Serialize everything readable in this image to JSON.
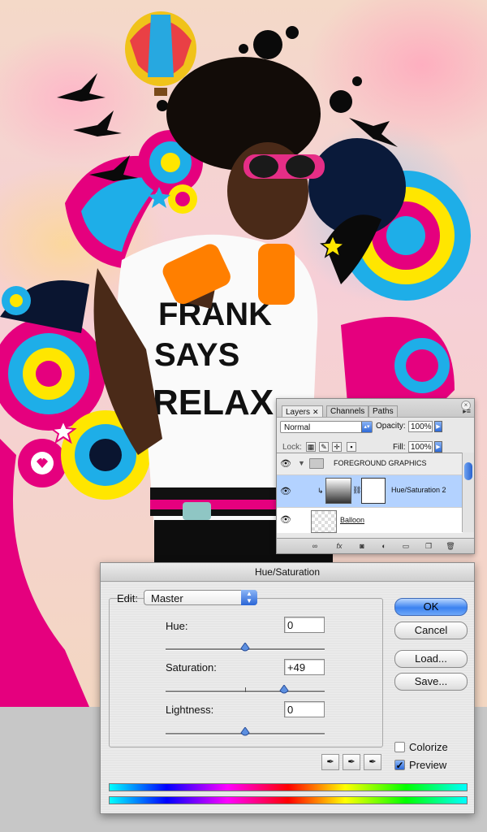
{
  "layers_panel": {
    "tabs": [
      "Layers",
      "Channels",
      "Paths"
    ],
    "tab_close": "✕",
    "blend_mode": "Normal",
    "opacity_label": "Opacity:",
    "opacity_value": "100%",
    "lock_label": "Lock:",
    "fill_label": "Fill:",
    "fill_value": "100%",
    "layers": [
      {
        "name": "FOREGROUND GRAPHICS"
      },
      {
        "name": "Hue/Saturation 2"
      },
      {
        "name": "Balloon"
      }
    ],
    "fx_label": "fx"
  },
  "dialog": {
    "title": "Hue/Saturation",
    "edit_label": "Edit:",
    "edit_value": "Master",
    "hue_label": "Hue:",
    "hue_value": "0",
    "saturation_label": "Saturation:",
    "saturation_value": "+49",
    "lightness_label": "Lightness:",
    "lightness_value": "0",
    "sliders": {
      "hue": 0,
      "saturation": 49,
      "lightness": 0
    },
    "buttons": {
      "ok": "OK",
      "cancel": "Cancel",
      "load": "Load...",
      "save": "Save..."
    },
    "colorize_label": "Colorize",
    "colorize_checked": false,
    "preview_label": "Preview",
    "preview_checked": true
  },
  "colors": {
    "accent": "#2f6fd9",
    "selected_layer": "#b3d2ff"
  }
}
